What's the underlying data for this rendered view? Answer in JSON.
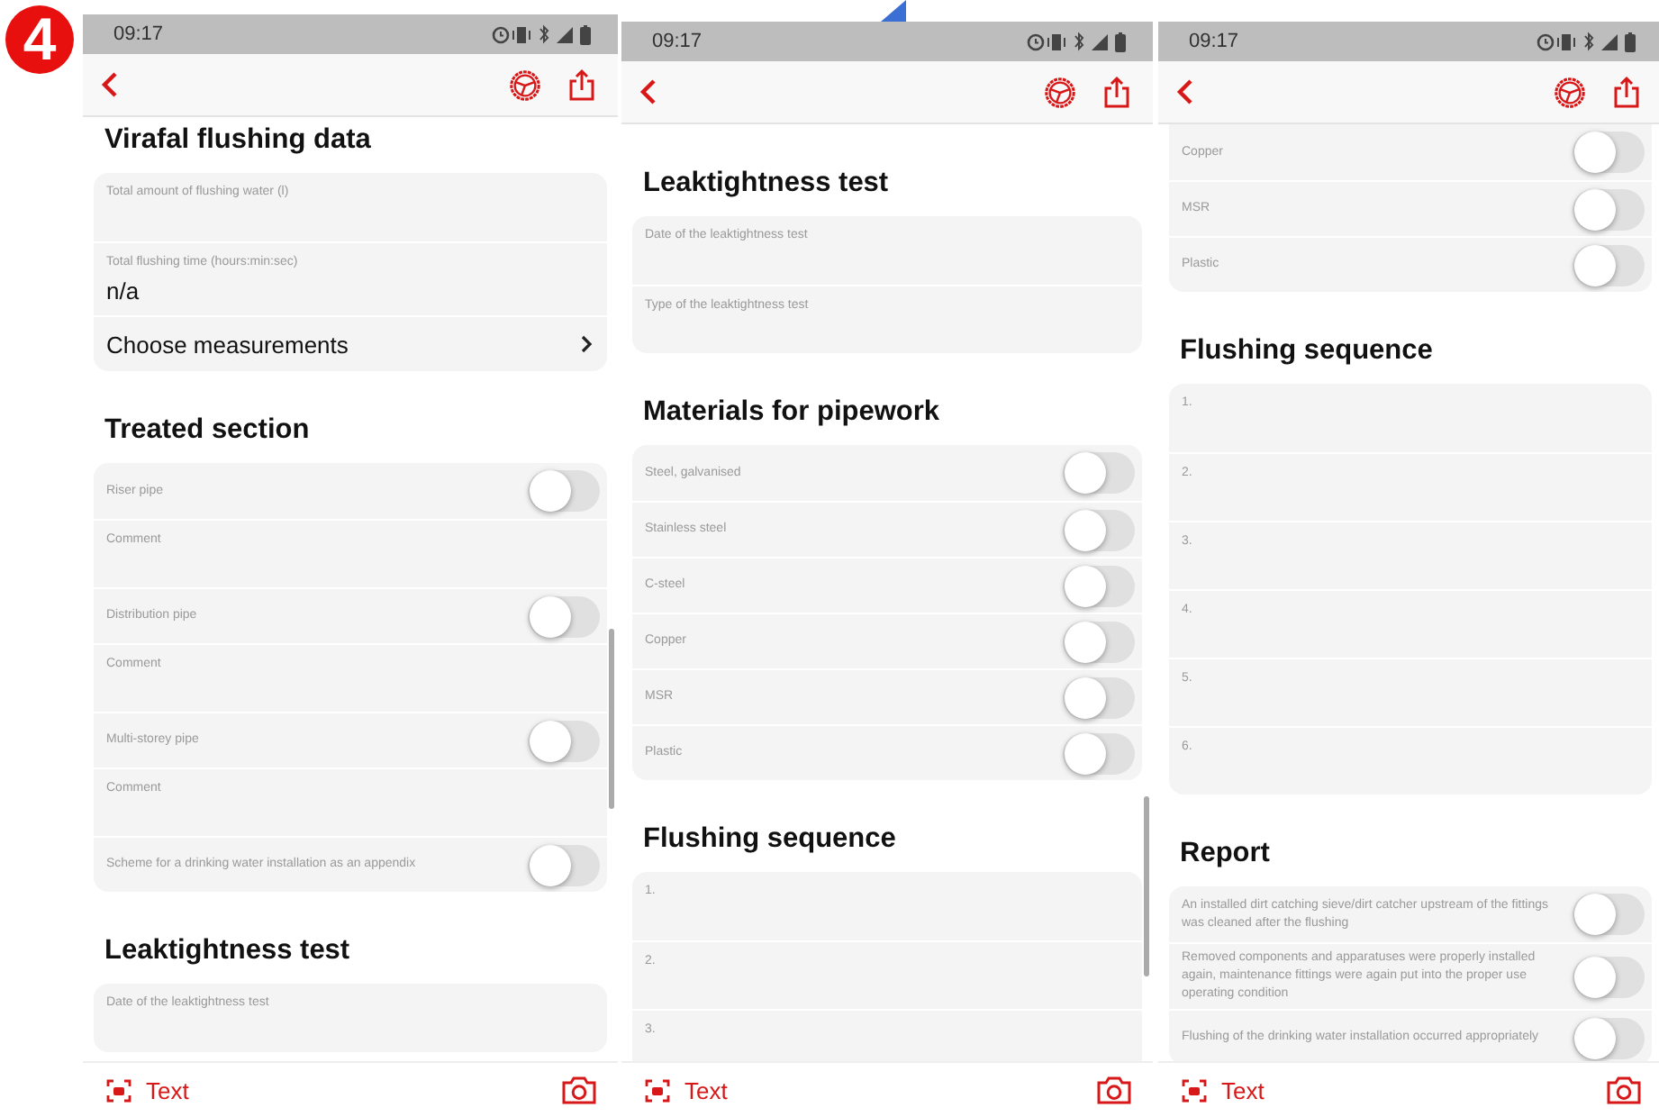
{
  "badge": "4",
  "screens": [
    {
      "time": "09:17",
      "sections": [
        {
          "heading": "Virafal flushing data",
          "rows": [
            {
              "kind": "field",
              "label": "Total amount of flushing water (l)"
            },
            {
              "kind": "field",
              "label": "Total flushing time (hours:min:sec)",
              "value": "n/a"
            },
            {
              "kind": "link",
              "label": "Choose measurements"
            }
          ]
        },
        {
          "heading": "Treated section",
          "rows": [
            {
              "kind": "toggle",
              "label": "Riser pipe",
              "on": false
            },
            {
              "kind": "field",
              "label": "Comment"
            },
            {
              "kind": "toggle",
              "label": "Distribution pipe",
              "on": false
            },
            {
              "kind": "field",
              "label": "Comment"
            },
            {
              "kind": "toggle",
              "label": "Multi-storey pipe",
              "on": false
            },
            {
              "kind": "field",
              "label": "Comment"
            },
            {
              "kind": "toggle",
              "label": "Scheme for a drinking water installation as an appendix",
              "on": false
            }
          ]
        },
        {
          "heading": "Leaktightness test",
          "rows": [
            {
              "kind": "field",
              "label": "Date of the leaktightness test"
            }
          ]
        }
      ],
      "text_button": "Text"
    },
    {
      "time": "09:17",
      "sections": [
        {
          "heading": "Leaktightness test",
          "rows": [
            {
              "kind": "field",
              "label": "Date of the leaktightness test"
            },
            {
              "kind": "field",
              "label": "Type of the leaktightness test"
            }
          ]
        },
        {
          "heading": "Materials for pipework",
          "rows": [
            {
              "kind": "toggle",
              "label": "Steel, galvanised",
              "on": false
            },
            {
              "kind": "toggle",
              "label": "Stainless steel",
              "on": false
            },
            {
              "kind": "toggle",
              "label": "C-steel",
              "on": false
            },
            {
              "kind": "toggle",
              "label": "Copper",
              "on": false
            },
            {
              "kind": "toggle",
              "label": "MSR",
              "on": false
            },
            {
              "kind": "toggle",
              "label": "Plastic",
              "on": false
            }
          ]
        },
        {
          "heading": "Flushing sequence",
          "rows": [
            {
              "kind": "field",
              "label": "1."
            },
            {
              "kind": "field",
              "label": "2."
            },
            {
              "kind": "field",
              "label": "3."
            }
          ]
        }
      ],
      "text_button": "Text"
    },
    {
      "time": "09:17",
      "sections": [
        {
          "rows": [
            {
              "kind": "toggle",
              "label": "Copper",
              "on": false
            },
            {
              "kind": "toggle",
              "label": "MSR",
              "on": false
            },
            {
              "kind": "toggle",
              "label": "Plastic",
              "on": false
            }
          ]
        },
        {
          "heading": "Flushing sequence",
          "rows": [
            {
              "kind": "field",
              "label": "1."
            },
            {
              "kind": "field",
              "label": "2."
            },
            {
              "kind": "field",
              "label": "3."
            },
            {
              "kind": "field",
              "label": "4."
            },
            {
              "kind": "field",
              "label": "5."
            },
            {
              "kind": "field",
              "label": "6."
            }
          ]
        },
        {
          "heading": "Report",
          "rows": [
            {
              "kind": "toggle",
              "label": "An installed dirt catching sieve/dirt catcher upstream of the fittings was cleaned after the flushing",
              "on": false
            },
            {
              "kind": "toggle",
              "label": "Removed components and apparatuses were properly installed again, maintenance fittings were again put into the proper use operating condition",
              "on": false
            },
            {
              "kind": "toggle",
              "label": "Flushing of the drinking water installation occurred appropriately",
              "on": false
            }
          ]
        }
      ],
      "text_button": "Text"
    }
  ]
}
